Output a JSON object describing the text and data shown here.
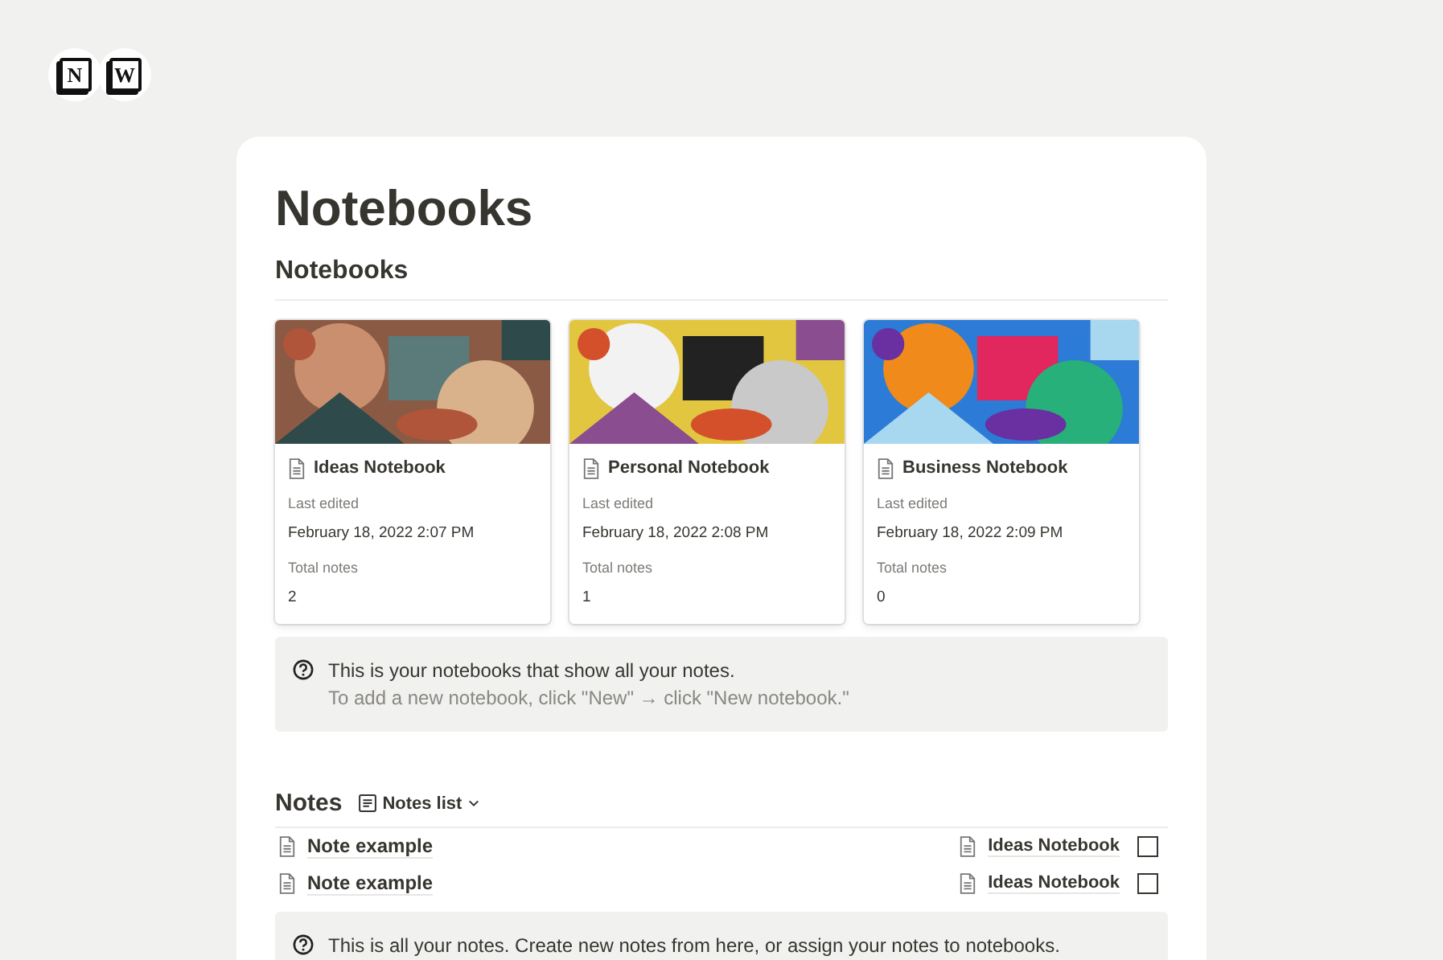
{
  "logos": [
    {
      "letter": "N"
    },
    {
      "letter": "W"
    }
  ],
  "page": {
    "title": "Notebooks"
  },
  "notebooks_section": {
    "heading": "Notebooks",
    "cards": [
      {
        "kind": "picture",
        "title": "Ideas Notebook",
        "edited_label": "Last edited",
        "edited": "February 18, 2022 2:07 PM",
        "total_label": "Total notes",
        "total": "2"
      },
      {
        "kind": "picture",
        "title": "Personal Notebook",
        "edited_label": "Last edited",
        "edited": "February 18, 2022 2:08 PM",
        "total_label": "Total notes",
        "total": "1"
      },
      {
        "kind": "picture",
        "title": "Business Notebook",
        "edited_label": "Last edited",
        "edited": "February 18, 2022 2:09 PM",
        "total_label": "Total notes",
        "total": "0"
      }
    ],
    "callout": {
      "line1": "This is your notebooks that show all your notes.",
      "line2": "To add a new notebook, click \"New\" → click \"New notebook.\""
    }
  },
  "notes_section": {
    "heading": "Notes",
    "view": "Notes list",
    "rows": [
      {
        "title": "Note example",
        "notebook": "Ideas Notebook",
        "checked": false
      },
      {
        "title": "Note example",
        "notebook": "Ideas Notebook",
        "checked": false
      }
    ],
    "callout": {
      "line1": "This is all your notes. Create new notes from here, or assign your notes to notebooks."
    }
  }
}
